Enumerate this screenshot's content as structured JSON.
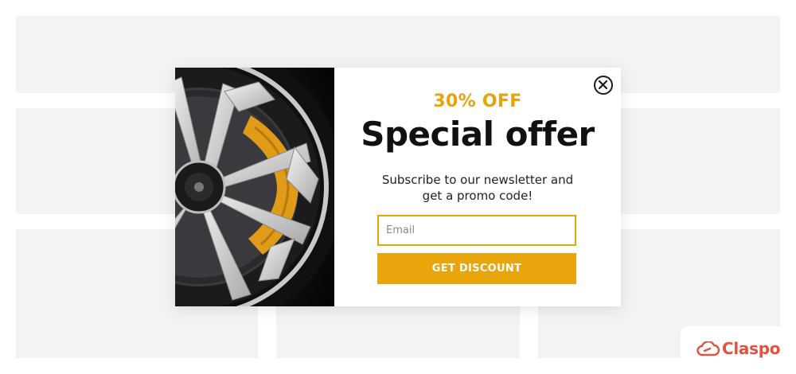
{
  "popup": {
    "discount_label": "30% OFF",
    "title": "Special offer",
    "subtitle": "Subscribe to our newsletter and get a promo code!",
    "email_placeholder": "Email",
    "button_label": "GET DISCOUNT",
    "image_alt": "car-wheel-with-orange-brake-caliper"
  },
  "brand": {
    "name": "Claspo",
    "icon": "cloud-link-icon"
  },
  "colors": {
    "accent": "#e5a50a",
    "brand": "#e0533d",
    "background_blocks": "#f2f3f5"
  }
}
